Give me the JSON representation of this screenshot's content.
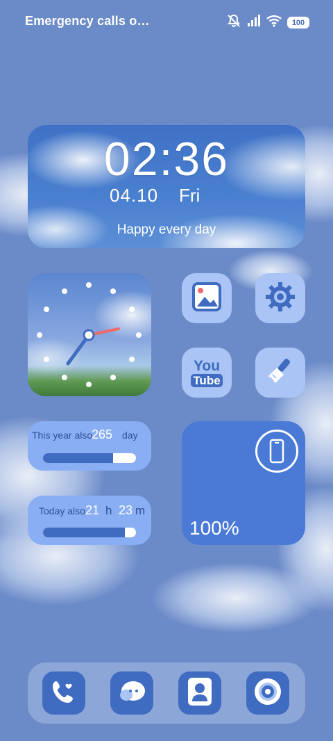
{
  "status": {
    "carrier_text": "Emergency calls o…",
    "battery_level": "100",
    "icons": [
      "mute-icon",
      "signal-icon",
      "wifi-icon",
      "battery-icon"
    ]
  },
  "clock_widget": {
    "time": "02:36",
    "date": "04.10",
    "day": "Fri",
    "motto": "Happy every day"
  },
  "apps": [
    {
      "name": "Gallery",
      "icon": "gallery-icon"
    },
    {
      "name": "Settings",
      "icon": "gear-icon"
    },
    {
      "name": "YouTube",
      "icon": "youtube-icon",
      "glyph_top": "You",
      "glyph_bottom": "Tube"
    },
    {
      "name": "Cleaner",
      "icon": "broom-icon"
    }
  ],
  "year_widget": {
    "prefix": "This year also",
    "value": "265",
    "unit": "day",
    "progress": 0.75
  },
  "today_widget": {
    "prefix": "Today also",
    "hours": "21",
    "hours_unit": "h",
    "minutes": "23",
    "minutes_unit": "m",
    "progress": 0.88
  },
  "battery_widget": {
    "percent": "100%"
  },
  "dock": [
    {
      "name": "Phone",
      "icon": "phone-icon"
    },
    {
      "name": "Messages",
      "icon": "chat-icon"
    },
    {
      "name": "Contacts",
      "icon": "contact-icon"
    },
    {
      "name": "Camera",
      "icon": "camera-icon"
    }
  ],
  "colors": {
    "background": "#6b8ac8",
    "icon_tile": "#a9c4f5",
    "icon_glyph": "#3f6bc0",
    "widget_fill": "#89aef4",
    "accent_red": "#f06a6a"
  }
}
